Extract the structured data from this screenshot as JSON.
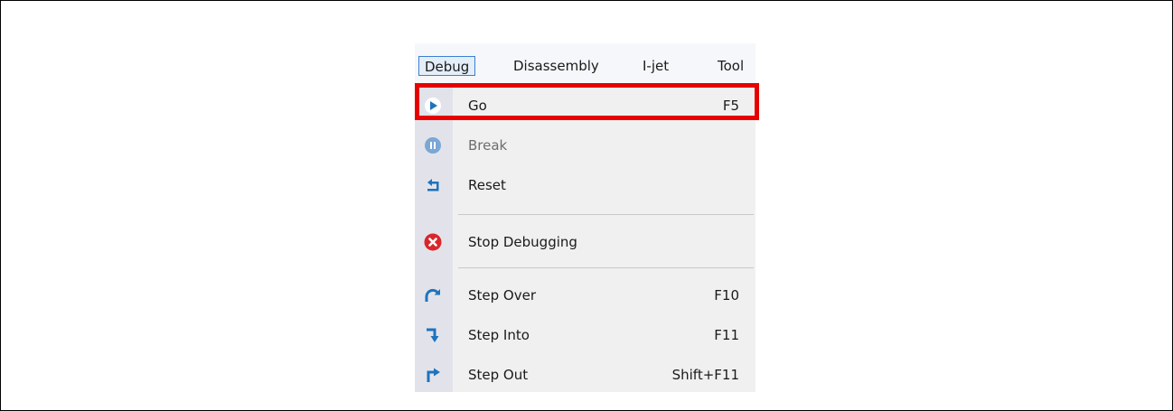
{
  "menubar": {
    "items": [
      {
        "label": "Debug",
        "active": true
      },
      {
        "label": "Disassembly",
        "active": false
      },
      {
        "label": "I-jet",
        "active": false
      },
      {
        "label": "Tool",
        "active": false
      }
    ]
  },
  "debug_menu": {
    "items": [
      {
        "label": "Go",
        "shortcut": "F5",
        "icon": "play-icon",
        "enabled": true,
        "highlighted": true
      },
      {
        "label": "Break",
        "shortcut": "",
        "icon": "pause-icon",
        "enabled": false
      },
      {
        "label": "Reset",
        "shortcut": "",
        "icon": "reset-icon",
        "enabled": true
      },
      {
        "label": "Stop Debugging",
        "shortcut": "",
        "icon": "stop-icon",
        "enabled": true
      },
      {
        "label": "Step Over",
        "shortcut": "F10",
        "icon": "step-over-icon",
        "enabled": true
      },
      {
        "label": "Step Into",
        "shortcut": "F11",
        "icon": "step-into-icon",
        "enabled": true
      },
      {
        "label": "Step Out",
        "shortcut": "Shift+F11",
        "icon": "step-out-icon",
        "enabled": true
      }
    ]
  },
  "colors": {
    "highlight_border": "#e60000",
    "icon_blue": "#1e73be",
    "icon_red": "#d9262b",
    "icon_disabled": "#7aa7d6"
  }
}
